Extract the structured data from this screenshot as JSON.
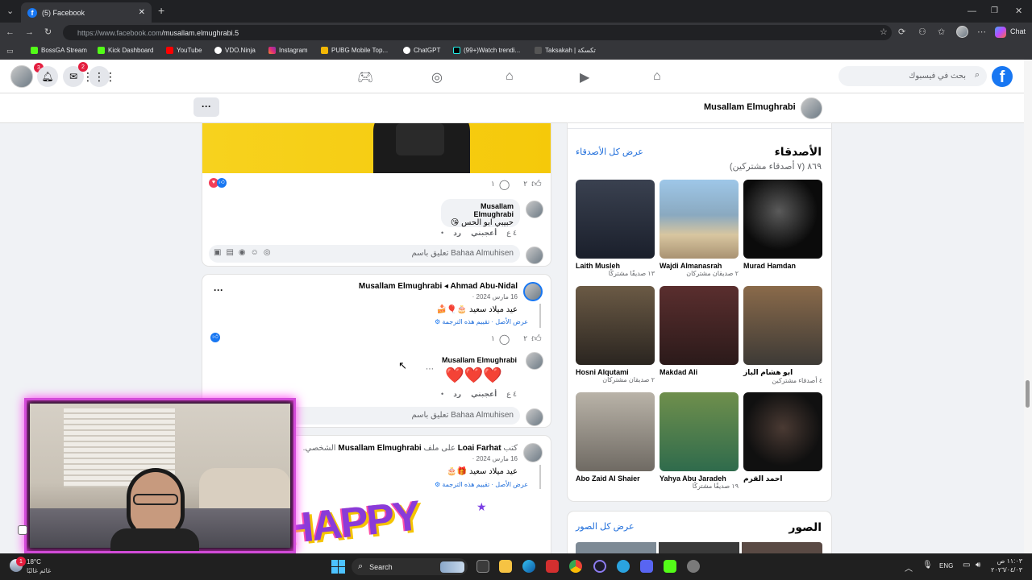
{
  "browser": {
    "tab_title": "(5) Facebook",
    "url_prefix": "https://www.facebook.com",
    "url_path": "/musallam.elmughrabi.5",
    "chat_label": "Chat",
    "bookmarks": [
      "BossGA Stream",
      "Kick Dashboard",
      "YouTube",
      "VDO.Ninja",
      "Instagram",
      "PUBG Mobile Top...",
      "ChatGPT",
      "(99+)Watch trendi...",
      "Taksakah | تكسكة"
    ]
  },
  "header": {
    "search_placeholder": "بحث في فيسبوك",
    "notifications_badge": "3",
    "messenger_badge": "2",
    "logo": "f"
  },
  "profile": {
    "name": "Musallam Elmughrabi",
    "more": "···"
  },
  "posts": [
    {
      "likes": "٢",
      "comments": "١",
      "comment": {
        "author": "Musallam Elmughrabi",
        "text": "حبيبي ابو الحس 😘",
        "time": "٤ ع",
        "like": "أعجبني",
        "reply": "رد",
        "dot": "•"
      },
      "input": {
        "placeholder": "تعليق باسم Bahaa Almuhisen"
      }
    },
    {
      "header": "Musallam Elmughrabi ◂ Ahmad Abu-Nidal",
      "date": "16 مارس 2024 ·",
      "text": "عيد ميلاد سعيد 🎂🎈🍰",
      "translate": "عرض الأصل · تقييم هذه الترجمة",
      "likes": "٢",
      "comments": "١",
      "comment": {
        "author": "Musallam Elmughrabi",
        "text": "❤️❤️❤️",
        "time": "٤ ع",
        "like": "أعجبني",
        "reply": "رد",
        "dot": "•"
      },
      "input": {
        "placeholder": "تعليق باسم Bahaa Almuhisen"
      },
      "more": "···"
    },
    {
      "header_prefix": "كتب",
      "header_author": "Loai Farhat",
      "header_mid": "على ملف",
      "header_target": "Musallam Elmughrabi",
      "header_suffix": "الشخصي.",
      "date": "16 مارس 2024 ·",
      "text": "عيد ميلاد سعيد 🎁🎂",
      "translate": "عرض الأصل · تقييم هذه الترجمة",
      "image_text": "HAPPY"
    }
  ],
  "friends": {
    "title": "الأصدقاء",
    "see_all": "عرض كل الأصدقاء",
    "count": "٨٦٩ (٧ أصدقاء مشتركين)",
    "items": [
      {
        "name": "Laith Musleh",
        "mutual": "١٣ صديقًا مشتركًا"
      },
      {
        "name": "Wajdi Almanasrah",
        "mutual": "٢ صديقان مشتركان"
      },
      {
        "name": "Murad Hamdan",
        "mutual": ""
      },
      {
        "name": "Hosni Alqutami",
        "mutual": "٢ صديقان مشتركان"
      },
      {
        "name": "Makdad Ali",
        "mutual": ""
      },
      {
        "name": "ابو هشام الباز",
        "mutual": "٤ أصدقاء مشتركين"
      },
      {
        "name": "Abo Zaid Al Shaier",
        "mutual": ""
      },
      {
        "name": "Yahya Abu Jaradeh",
        "mutual": "١٩ صديقًا مشتركًا"
      },
      {
        "name": "احمد القرم",
        "mutual": ""
      }
    ]
  },
  "photos": {
    "title": "الصور",
    "see_all": "عرض كل الصور"
  },
  "taskbar": {
    "weather_temp": "18°C",
    "weather_desc": "غائم غالبًا",
    "search": "Search",
    "lang": "ENG",
    "time": "١١:٠٣ ص",
    "date": "٢٠٢٦/٠٤/٠٣",
    "weather_badge": "1"
  }
}
